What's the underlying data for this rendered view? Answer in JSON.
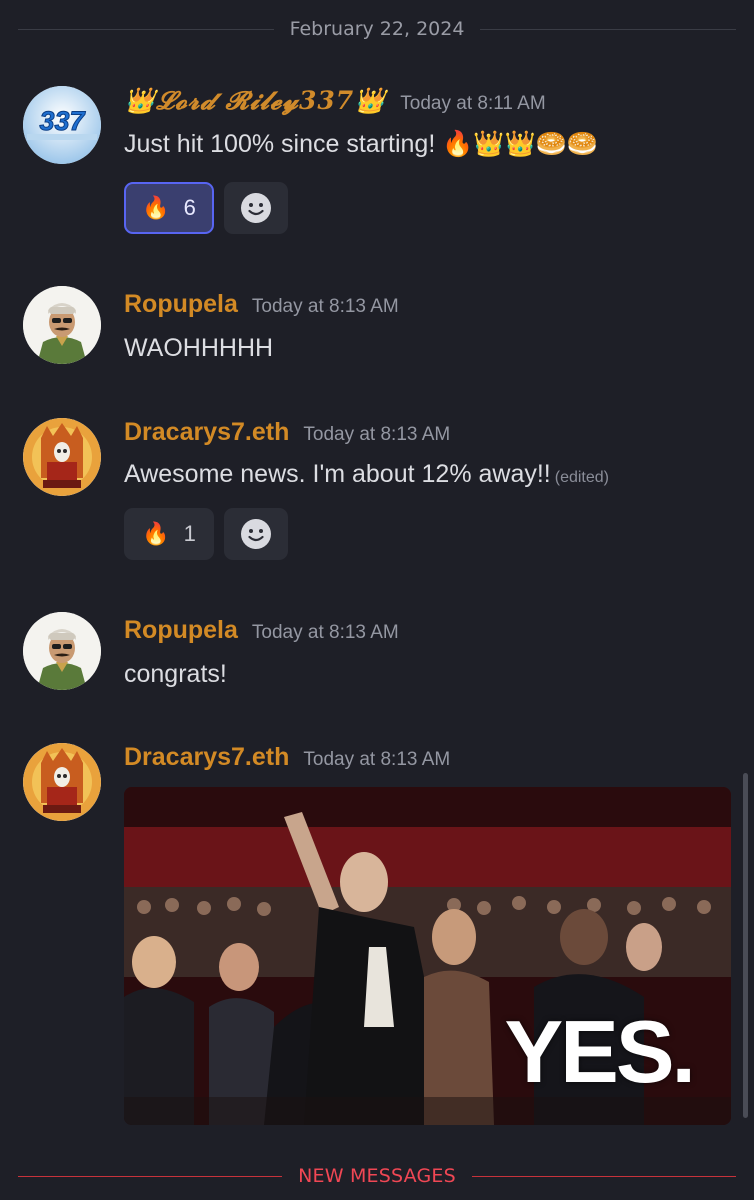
{
  "date_divider": "February 22, 2024",
  "new_messages_label": "NEW MESSAGES",
  "messages": [
    {
      "author": "👑𝓛𝓸𝓻𝓭 𝓡𝓲𝓵𝓮𝔂337👑",
      "timestamp": "Today at 8:11 AM",
      "avatar_text": "337",
      "text": "Just hit 100% since starting! 🔥👑👑🥯🥯",
      "reactions": [
        {
          "emoji": "🔥",
          "count": "6",
          "selected": true
        }
      ]
    },
    {
      "author": "Ropupela",
      "timestamp": "Today at 8:13 AM",
      "text": "WAOHHHHH"
    },
    {
      "author": "Dracarys7.eth",
      "timestamp": "Today at 8:13 AM",
      "text": "Awesome news. I'm about 12% away!!",
      "edited": "(edited)",
      "reactions": [
        {
          "emoji": "🔥",
          "count": "1",
          "selected": false
        }
      ]
    },
    {
      "author": "Ropupela",
      "timestamp": "Today at 8:13 AM",
      "text": "congrats!"
    },
    {
      "author": "Dracarys7.eth",
      "timestamp": "Today at 8:13 AM",
      "gif_caption": "YES."
    }
  ],
  "icons": {
    "add_reaction": "smiley-face-icon"
  },
  "colors": {
    "author": "#d38a25",
    "new_messages": "#f04754",
    "reaction_selected_border": "#5865f2"
  }
}
